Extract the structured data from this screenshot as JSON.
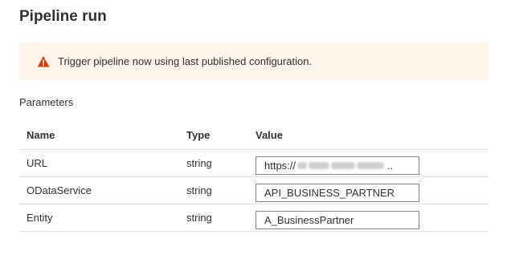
{
  "page": {
    "title": "Pipeline run"
  },
  "warning": {
    "text": "Trigger pipeline now using last published configuration.",
    "icon": "warning-triangle-icon",
    "icon_color": "#d83b01",
    "background": "#fdf4ec"
  },
  "parameters": {
    "section_label": "Parameters",
    "columns": {
      "name": "Name",
      "type": "Type",
      "value": "Value"
    },
    "rows": [
      {
        "name": "URL",
        "type": "string",
        "value": "https://",
        "value_suffix": ".."
      },
      {
        "name": "ODataService",
        "type": "string",
        "value": "API_BUSINESS_PARTNER"
      },
      {
        "name": "Entity",
        "type": "string",
        "value": "A_BusinessPartner"
      }
    ]
  }
}
